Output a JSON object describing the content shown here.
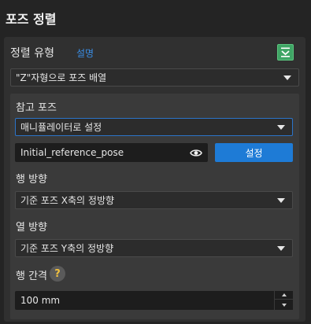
{
  "page": {
    "title": "포즈 정렬"
  },
  "sort_type": {
    "label": "정렬 유형",
    "help_link": "설명",
    "collapse_icon": "chevron-down-icon",
    "selected": "\"Z\"자형으로 포즈 배열"
  },
  "reference_pose": {
    "label": "참고 포즈",
    "source_selected": "매니퓰레이터로 설정",
    "name_value": "Initial_reference_pose",
    "eye_icon": "eye-icon",
    "set_button": "설정"
  },
  "row_direction": {
    "label": "행 방향",
    "selected": "기준 포즈 X축의 정방향"
  },
  "column_direction": {
    "label": "열 방향",
    "selected": "기준 포즈 Y축의 정방향"
  },
  "row_spacing": {
    "label": "행 간격",
    "help_icon": "?",
    "value": "100 mm"
  },
  "colors": {
    "accent": "#1e7bd6",
    "link": "#3a8ee6",
    "collapse_button": "#3fa565",
    "help_icon_glyph": "#f0c040"
  }
}
